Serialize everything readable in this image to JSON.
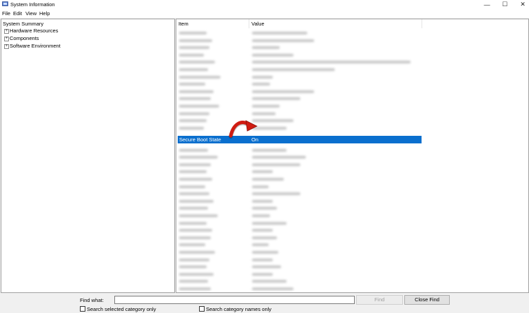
{
  "window": {
    "title": "System Information",
    "controls": {
      "minimize": "—",
      "maximize": "☐",
      "close": "✕"
    }
  },
  "menu": [
    "File",
    "Edit",
    "View",
    "Help"
  ],
  "tree": {
    "root": "System Summary",
    "children": [
      "Hardware Resources",
      "Components",
      "Software Environment"
    ]
  },
  "table": {
    "columns": [
      "Item",
      "Value"
    ],
    "selected_row": {
      "item": "Secure Boot State",
      "value": "On"
    }
  },
  "find": {
    "label": "Find what:",
    "value": "",
    "find_button": "Find",
    "close_button": "Close Find",
    "option1": "Search selected category only",
    "option2": "Search category names only"
  },
  "colors": {
    "selection": "#0a6fce",
    "arrow": "#d01c12"
  }
}
